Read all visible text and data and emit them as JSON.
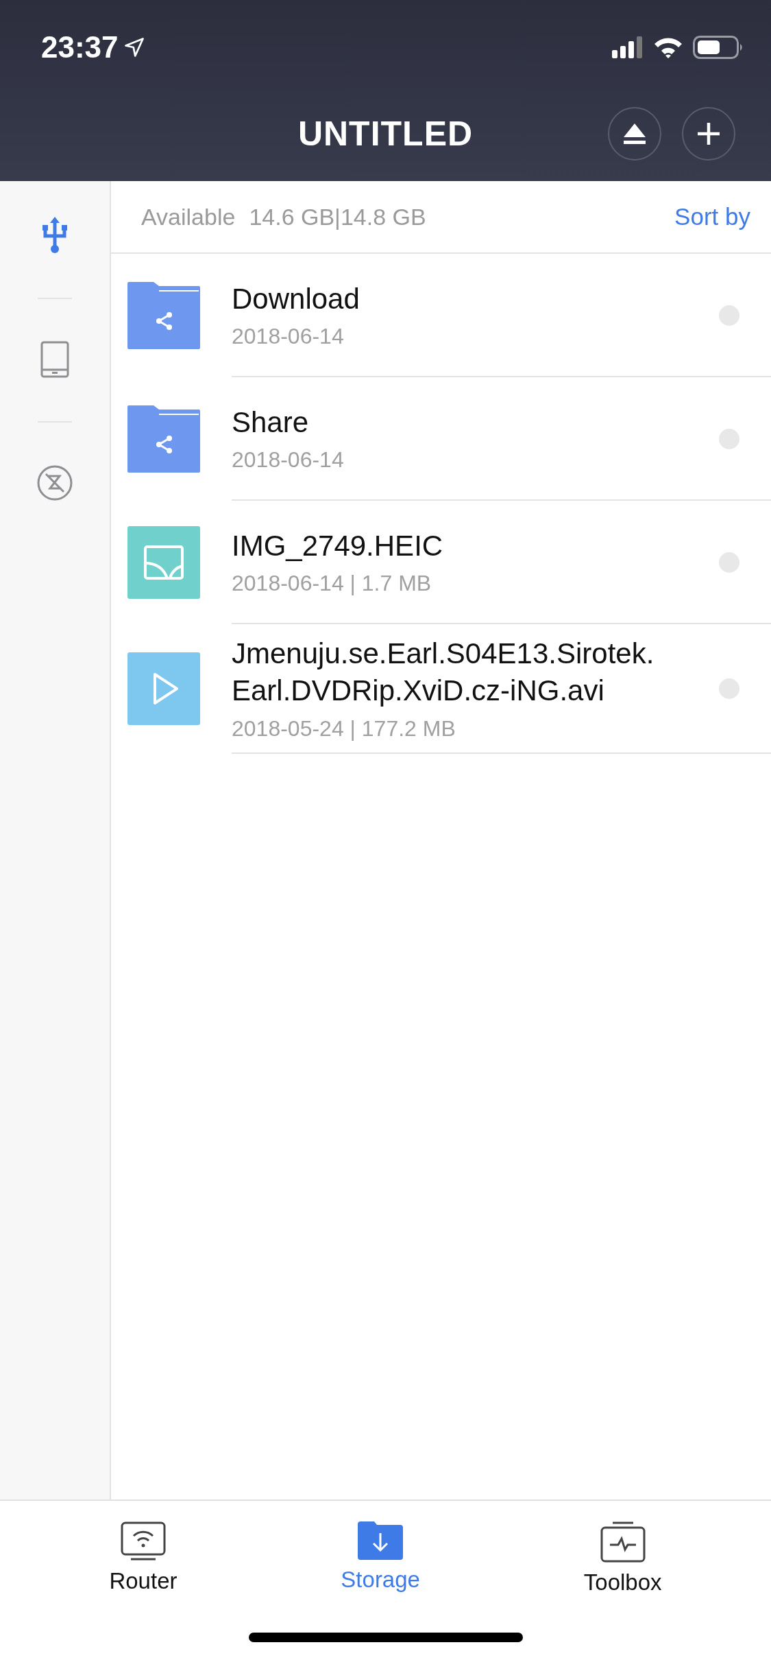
{
  "status_bar": {
    "time": "23:37"
  },
  "header": {
    "title": "UNTITLED"
  },
  "sidebar": {
    "items": [
      {
        "kind": "usb",
        "selected": true
      },
      {
        "kind": "tablet",
        "selected": false
      },
      {
        "kind": "blocked",
        "selected": false
      }
    ]
  },
  "info_bar": {
    "label": "Available",
    "value": "14.6 GB|14.8 GB",
    "sort": "Sort by"
  },
  "files": [
    {
      "kind": "folder",
      "name": "Download",
      "meta": "2018-06-14",
      "selected": false
    },
    {
      "kind": "folder",
      "name": "Share",
      "meta": "2018-06-14",
      "selected": false
    },
    {
      "kind": "image",
      "name": "IMG_2749.HEIC",
      "meta": "2018-06-14 | 1.7 MB",
      "selected": false
    },
    {
      "kind": "video",
      "name": "Jmenuju.se.Earl.S04E13.Sirotek.Earl.DVDRip.XviD.cz-iNG.avi",
      "meta": "2018-05-24 | 177.2 MB",
      "selected": false
    }
  ],
  "tabs": [
    {
      "kind": "router",
      "label": "Router",
      "selected": false
    },
    {
      "kind": "storage",
      "label": "Storage",
      "selected": true
    },
    {
      "kind": "toolbox",
      "label": "Toolbox",
      "selected": false
    }
  ]
}
